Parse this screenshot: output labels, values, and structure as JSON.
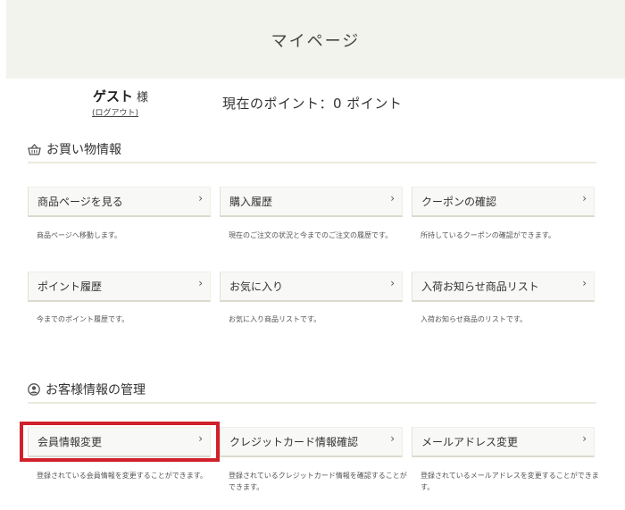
{
  "header": {
    "title": "マイページ"
  },
  "user": {
    "name": "ゲスト",
    "suffix": "様",
    "logout_label": "(ログアウト)"
  },
  "points": {
    "text": "現在のポイント：0 ポイント"
  },
  "sections": [
    {
      "title": "お買い物情報",
      "icon": "basket-icon",
      "cards": [
        {
          "label": "商品ページを見る",
          "desc": "商品ページへ移動します。"
        },
        {
          "label": "購入履歴",
          "desc": "現在のご注文の状況と今までのご注文の履歴です。"
        },
        {
          "label": "クーポンの確認",
          "desc": "所持しているクーポンの確認ができます。"
        },
        {
          "label": "ポイント履歴",
          "desc": "今までのポイント履歴です。"
        },
        {
          "label": "お気に入り",
          "desc": "お気に入り商品リストです。"
        },
        {
          "label": "入荷お知らせ商品リスト",
          "desc": "入荷お知らせ商品のリストです。"
        }
      ]
    },
    {
      "title": "お客様情報の管理",
      "icon": "user-circle-icon",
      "cards": [
        {
          "label": "会員情報変更",
          "desc": "登録されている会員情報を変更することができます。"
        },
        {
          "label": "クレジットカード情報確認",
          "desc": "登録されているクレジットカード情報を確認することができます。"
        },
        {
          "label": "メールアドレス変更",
          "desc": "登録されているメールアドレスを変更することができます。"
        }
      ]
    }
  ],
  "chevron": "›",
  "colors": {
    "header_bg": "#f3f3ed",
    "highlight": "#d0202a"
  }
}
